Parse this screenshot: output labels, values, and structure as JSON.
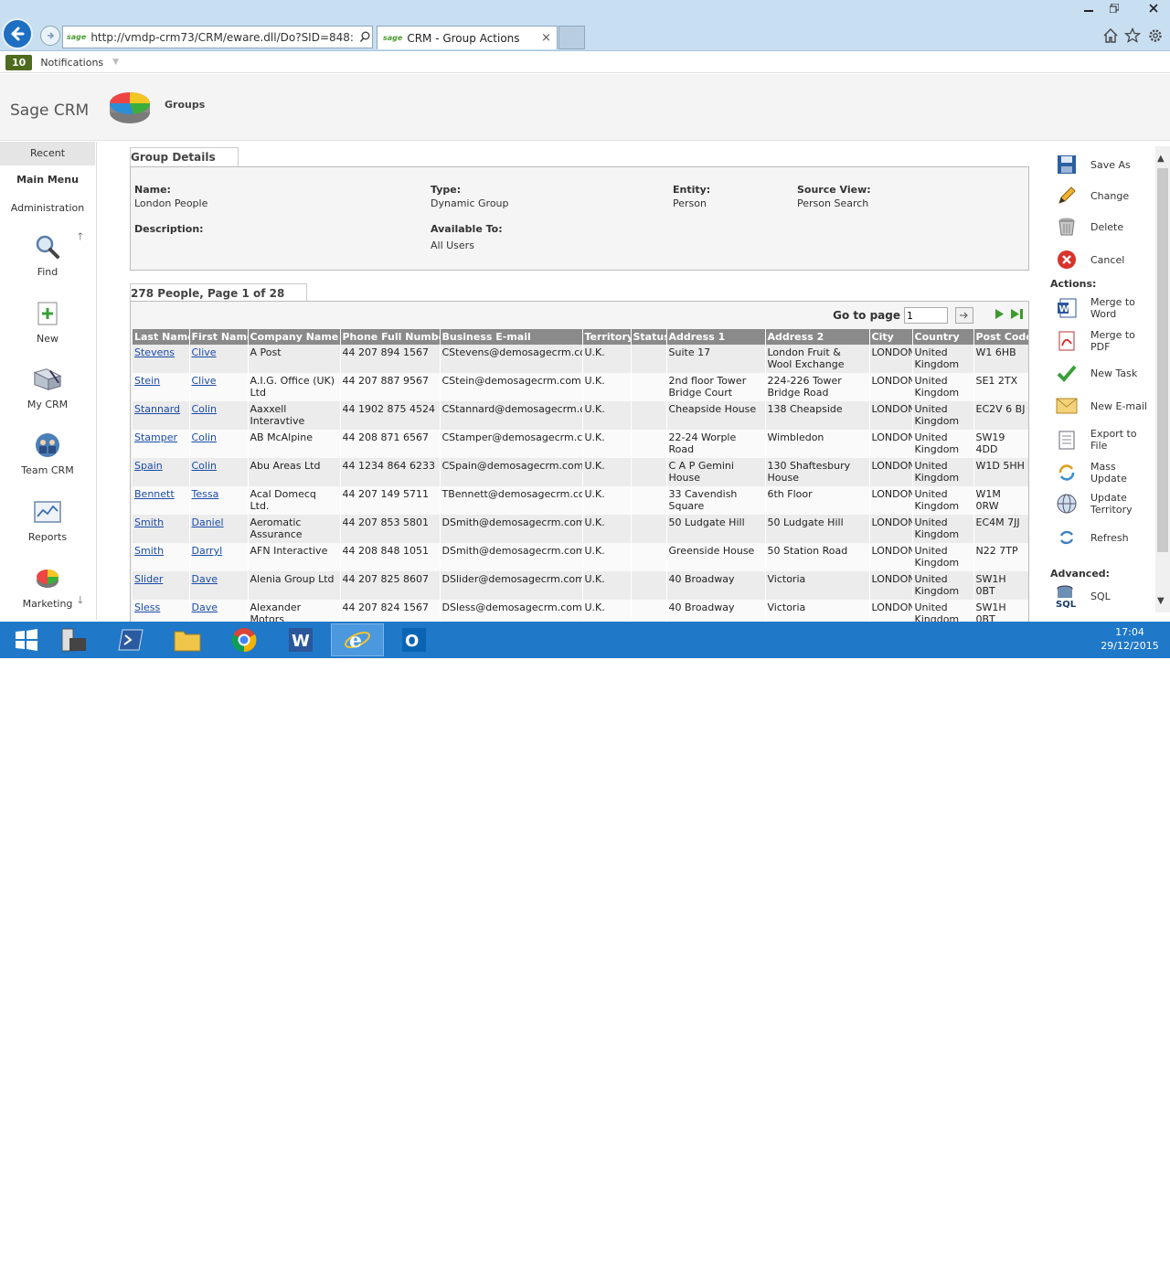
{
  "browser": {
    "url": "http://vmdp-crm73/CRM/eware.dll/Do?SID=848:",
    "url_brand": "sage",
    "tab_title": "CRM - Group Actions",
    "tab_brand": "sage",
    "tab_close": "×"
  },
  "notifications": {
    "count": "10",
    "label": "Notifications"
  },
  "header": {
    "brand": "Sage CRM",
    "title": "Groups"
  },
  "leftnav": {
    "recent": "Recent",
    "main_menu": "Main Menu",
    "administration": "Administration",
    "items": [
      {
        "label": "Find",
        "icon": "find-icon"
      },
      {
        "label": "New",
        "icon": "new-icon"
      },
      {
        "label": "My CRM",
        "icon": "my-crm-icon"
      },
      {
        "label": "Team CRM",
        "icon": "team-crm-icon"
      },
      {
        "label": "Reports",
        "icon": "reports-icon"
      },
      {
        "label": "Marketing",
        "icon": "marketing-icon"
      }
    ]
  },
  "details": {
    "tab": "Group Details",
    "name_label": "Name:",
    "name": "London People",
    "type_label": "Type:",
    "type": "Dynamic Group",
    "entity_label": "Entity:",
    "entity": "Person",
    "source_label": "Source View:",
    "source": "Person Search",
    "desc_label": "Description:",
    "avail_label": "Available To:",
    "avail": "All Users"
  },
  "list": {
    "tab": "278 People, Page 1 of 28",
    "goto_label": "Go to page",
    "page_value": "1",
    "columns": [
      "Last Name",
      "First Name",
      "Company Name",
      "Phone Full Number",
      "Business E-mail",
      "Territory",
      "Status",
      "Address 1",
      "Address 2",
      "City",
      "Country",
      "Post Code"
    ],
    "rows": [
      [
        "Stevens",
        "Clive",
        "A Post",
        "44 207 894 1567",
        "CStevens@demosagecrm.com",
        "U.K.",
        "",
        "Suite 17",
        "London Fruit & Wool Exchange",
        "LONDON",
        "United Kingdom",
        "W1 6HB"
      ],
      [
        "Stein",
        "Clive",
        "A.I.G. Office (UK) Ltd",
        "44 207 887 9567",
        "CStein@demosagecrm.com",
        "U.K.",
        "",
        "2nd floor Tower Bridge Court",
        "224-226 Tower Bridge Road",
        "LONDON",
        "United Kingdom",
        "SE1 2TX"
      ],
      [
        "Stannard",
        "Colin",
        "Aaxxell Interavtive",
        "44 1902 875 4524",
        "CStannard@demosagecrm.com",
        "U.K.",
        "",
        "Cheapside House",
        "138 Cheapside",
        "LONDON",
        "United Kingdom",
        "EC2V 6 BJ"
      ],
      [
        "Stamper",
        "Colin",
        "AB McAlpine",
        "44 208 871 6567",
        "CStamper@demosagecrm.com",
        "U.K.",
        "",
        "22-24 Worple Road",
        "Wimbledon",
        "LONDON",
        "United Kingdom",
        "SW19 4DD"
      ],
      [
        "Spain",
        "Colin",
        "Abu Areas Ltd",
        "44 1234 864 6233",
        "CSpain@demosagecrm.com",
        "U.K.",
        "",
        "C A P Gemini House",
        "130 Shaftesbury House",
        "LONDON",
        "United Kingdom",
        "W1D 5HH"
      ],
      [
        "Bennett",
        "Tessa",
        "Acal Domecq Ltd.",
        "44 207 149 5711",
        "TBennett@demosagecrm.com",
        "U.K.",
        "",
        "33 Cavendish Square",
        "6th Floor",
        "LONDON",
        "United Kingdom",
        "W1M 0RW"
      ],
      [
        "Smith",
        "Daniel",
        "Aeromatic Assurance",
        "44 207 853 5801",
        "DSmith@demosagecrm.com",
        "U.K.",
        "",
        "50 Ludgate Hill",
        "50 Ludgate Hill",
        "LONDON",
        "United Kingdom",
        "EC4M 7JJ"
      ],
      [
        "Smith",
        "Darryl",
        "AFN Interactive",
        "44 208 848 1051",
        "DSmith@demosagecrm.com",
        "U.K.",
        "",
        "Greenside House",
        "50 Station Road",
        "LONDON",
        "United Kingdom",
        "N22 7TP"
      ],
      [
        "Slider",
        "Dave",
        "Alenia Group Ltd",
        "44 207 825 8607",
        "DSlider@demosagecrm.com",
        "U.K.",
        "",
        "40 Broadway",
        "Victoria",
        "LONDON",
        "United Kingdom",
        "SW1H 0BT"
      ],
      [
        "Sless",
        "Dave",
        "Alexander Motors",
        "44 207 824 1567",
        "DSless@demosagecrm.com",
        "U.K.",
        "",
        "40 Broadway",
        "Victoria",
        "LONDON",
        "United Kingdom",
        "SW1H 0BT"
      ]
    ]
  },
  "actions": {
    "save_as": "Save As",
    "change": "Change",
    "delete": "Delete",
    "cancel": "Cancel",
    "actions_label": "Actions:",
    "merge_word": "Merge to Word",
    "merge_pdf": "Merge to PDF",
    "new_task": "New Task",
    "new_email": "New E-mail",
    "export": "Export to File",
    "mass_update": "Mass Update",
    "update_territory": "Update Territory",
    "refresh": "Refresh",
    "advanced_label": "Advanced:",
    "sql": "SQL"
  },
  "taskbar": {
    "time": "17:04",
    "date": "29/12/2015"
  },
  "colors": {
    "header_row": "#8a8a8a",
    "link": "#1a4ba8",
    "taskbar": "#1f78c8",
    "ie_chrome": "#c8def1"
  }
}
